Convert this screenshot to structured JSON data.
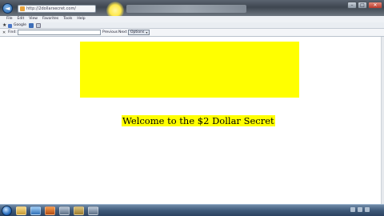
{
  "browser": {
    "address_url": "http://2dollarsecret.com/",
    "nav_back_glyph": "◄"
  },
  "window_buttons": {
    "minimize": "–",
    "maximize": "□",
    "close": "✕"
  },
  "menubar": [
    "File",
    "Edit",
    "View",
    "Favorites",
    "Tools",
    "Help"
  ],
  "favorites": {
    "star_glyph": "★",
    "google_label": "Google"
  },
  "findbar": {
    "close_glyph": "✕",
    "find_label": "Find:",
    "find_value": "",
    "previous_label": "Previous",
    "next_label": "Next",
    "options_label": "Options",
    "options_chevron": "▾"
  },
  "page": {
    "banner_color": "#ffff00",
    "welcome_text": "Welcome to the $2 Dollar Secret"
  },
  "taskbar": {
    "apps": [
      "folder",
      "ie",
      "media",
      "other",
      "active",
      "other"
    ]
  },
  "icons": {
    "back": "back-arrow-icon",
    "start": "windows-start-icon",
    "star": "favorites-star-icon"
  }
}
